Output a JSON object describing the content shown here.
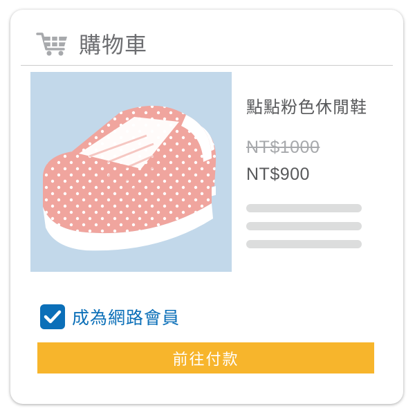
{
  "header": {
    "icon": "shopping-cart-icon",
    "title": "購物車"
  },
  "product": {
    "image": "pink-polka-dot-sneakers",
    "name": "點點粉色休閒鞋",
    "original_price": "NT$1000",
    "sale_price": "NT$900"
  },
  "membership": {
    "checked": true,
    "label": "成為網路會員"
  },
  "checkout": {
    "button_label": "前往付款"
  },
  "colors": {
    "accent": "#0b6fb8",
    "button": "#f7b52c",
    "image_background": "#c2d8ea",
    "shoe": "#f0a59e"
  }
}
